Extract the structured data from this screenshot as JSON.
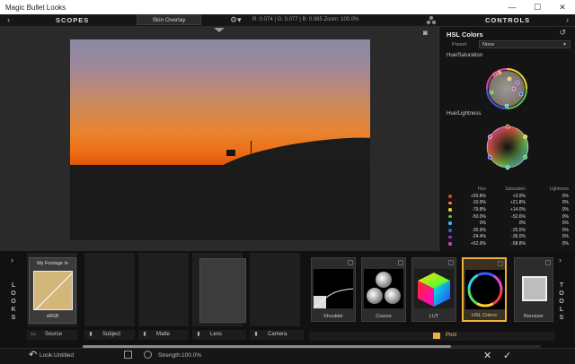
{
  "window": {
    "title": "Magic Bullet Looks",
    "minimize": "—",
    "maximize": "☐",
    "close": "✕"
  },
  "header": {
    "left_arrow": "›",
    "scopes": "SCOPES",
    "skin_overlay": "Skin Overlay",
    "readout": "R: 0.074  |  G: 0.077  |  B: 0.085     Zoom: 100.0%",
    "controls": "CONTROLS",
    "right_arrow": "›"
  },
  "panel": {
    "title": "HSL Colors",
    "preset_label": "Preset:",
    "preset_value": "None",
    "hue_saturation_label": "Hue/Saturation",
    "hue_lightness_label": "Hue/Lightness",
    "table": {
      "headers": [
        "Hue",
        "Saturation",
        "Lightness"
      ],
      "rows": [
        {
          "color": "#e23b2e",
          "hue": "+55.8%",
          "sat": "+3.9%",
          "light": "0%"
        },
        {
          "color": "#f28b22",
          "hue": "-10.9%",
          "sat": "+21.8%",
          "light": "0%"
        },
        {
          "color": "#e6d22e",
          "hue": "-79.8%",
          "sat": "+14.0%",
          "light": "0%"
        },
        {
          "color": "#4ec34a",
          "hue": "-50.0%",
          "sat": "-52.6%",
          "light": "0%"
        },
        {
          "color": "#36c6d6",
          "hue": "0%",
          "sat": "0%",
          "light": "0%"
        },
        {
          "color": "#3a56d8",
          "hue": "-30.9%",
          "sat": "-25.5%",
          "light": "0%"
        },
        {
          "color": "#8a44d0",
          "hue": "-24.4%",
          "sat": "-36.0%",
          "light": "0%"
        },
        {
          "color": "#d43fb4",
          "hue": "+52.9%",
          "sat": "-58.8%",
          "light": "0%"
        }
      ]
    }
  },
  "strip": {
    "looks_label": [
      "L",
      "O",
      "O",
      "K",
      "S"
    ],
    "tools_label": [
      "T",
      "O",
      "O",
      "L",
      "S"
    ],
    "left_arrow": "›",
    "right_arrow": "›",
    "source_tile_title": "My Footage Is",
    "source_tile_bottom": "sRGB",
    "categories": {
      "source": "Source",
      "subject": "Subject",
      "matte": "Matte",
      "lens": "Lens",
      "camera": "Camera",
      "post": "Post"
    },
    "tools": [
      {
        "name": "Shoulder"
      },
      {
        "name": "Cosmo"
      },
      {
        "name": "LUT"
      },
      {
        "name": "HSL Colors"
      },
      {
        "name": "Renoiser"
      }
    ]
  },
  "status": {
    "undo_icon": "↶",
    "look_label": "Look:",
    "look_value": "Untitled",
    "strength_label": "Strength:",
    "strength_value": "100.0%",
    "cancel": "✕",
    "ok": "✓"
  },
  "colors": {
    "accent": "#f1b03d",
    "panel_bg": "#141414",
    "app_bg": "#1e1e1e"
  }
}
